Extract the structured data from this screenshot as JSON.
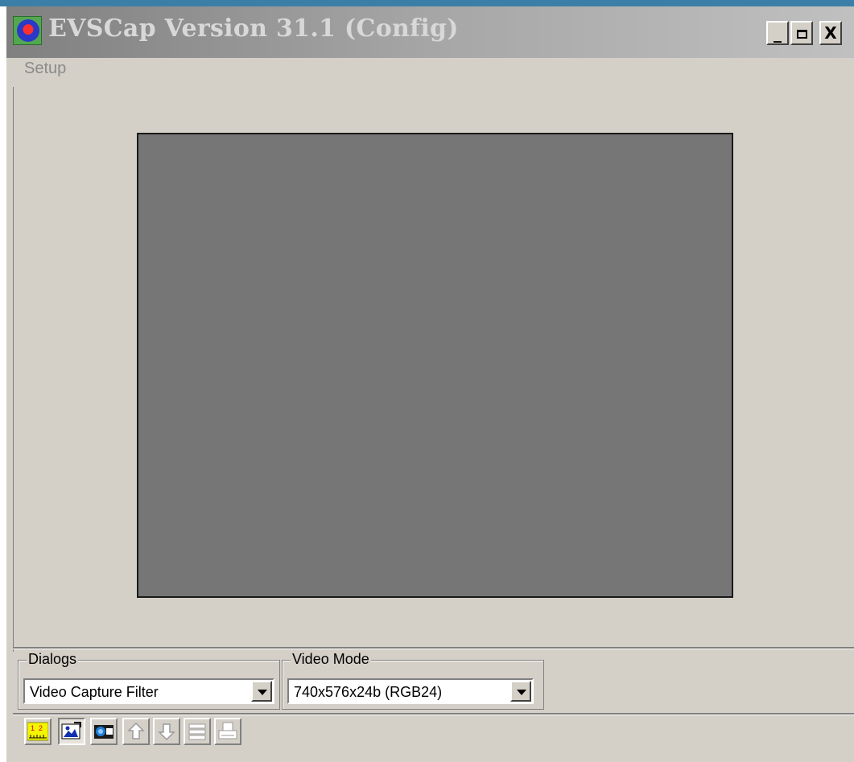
{
  "window": {
    "title": "EVSCap Version 31.1 (Config)",
    "controls": {
      "minimize": "_",
      "maximize": "□",
      "close": "X"
    }
  },
  "menu": {
    "items": [
      "Setup"
    ]
  },
  "dialogs_group": {
    "label": "Dialogs",
    "selected": "Video Capture Filter"
  },
  "video_mode_group": {
    "label": "Video Mode",
    "selected": "740x576x24b (RGB24)"
  },
  "toolbar": {
    "buttons": [
      {
        "icon": "ruler-scale-icon",
        "state": "raised",
        "enabled": true
      },
      {
        "icon": "video-capture-icon",
        "state": "pressed",
        "enabled": true
      },
      {
        "icon": "camera-snapshot-icon",
        "state": "raised",
        "enabled": true
      },
      {
        "icon": "arrow-up-icon",
        "state": "raised",
        "enabled": false
      },
      {
        "icon": "arrow-down-icon",
        "state": "raised",
        "enabled": false
      },
      {
        "icon": "list-settings-icon",
        "state": "raised",
        "enabled": false
      },
      {
        "icon": "printer-icon",
        "state": "raised",
        "enabled": false
      }
    ]
  },
  "colors": {
    "title_bar_inactive": "#808080",
    "face": "#d4d0c8",
    "video_area": "#767676",
    "disabled_text": "#8a8a8a"
  }
}
